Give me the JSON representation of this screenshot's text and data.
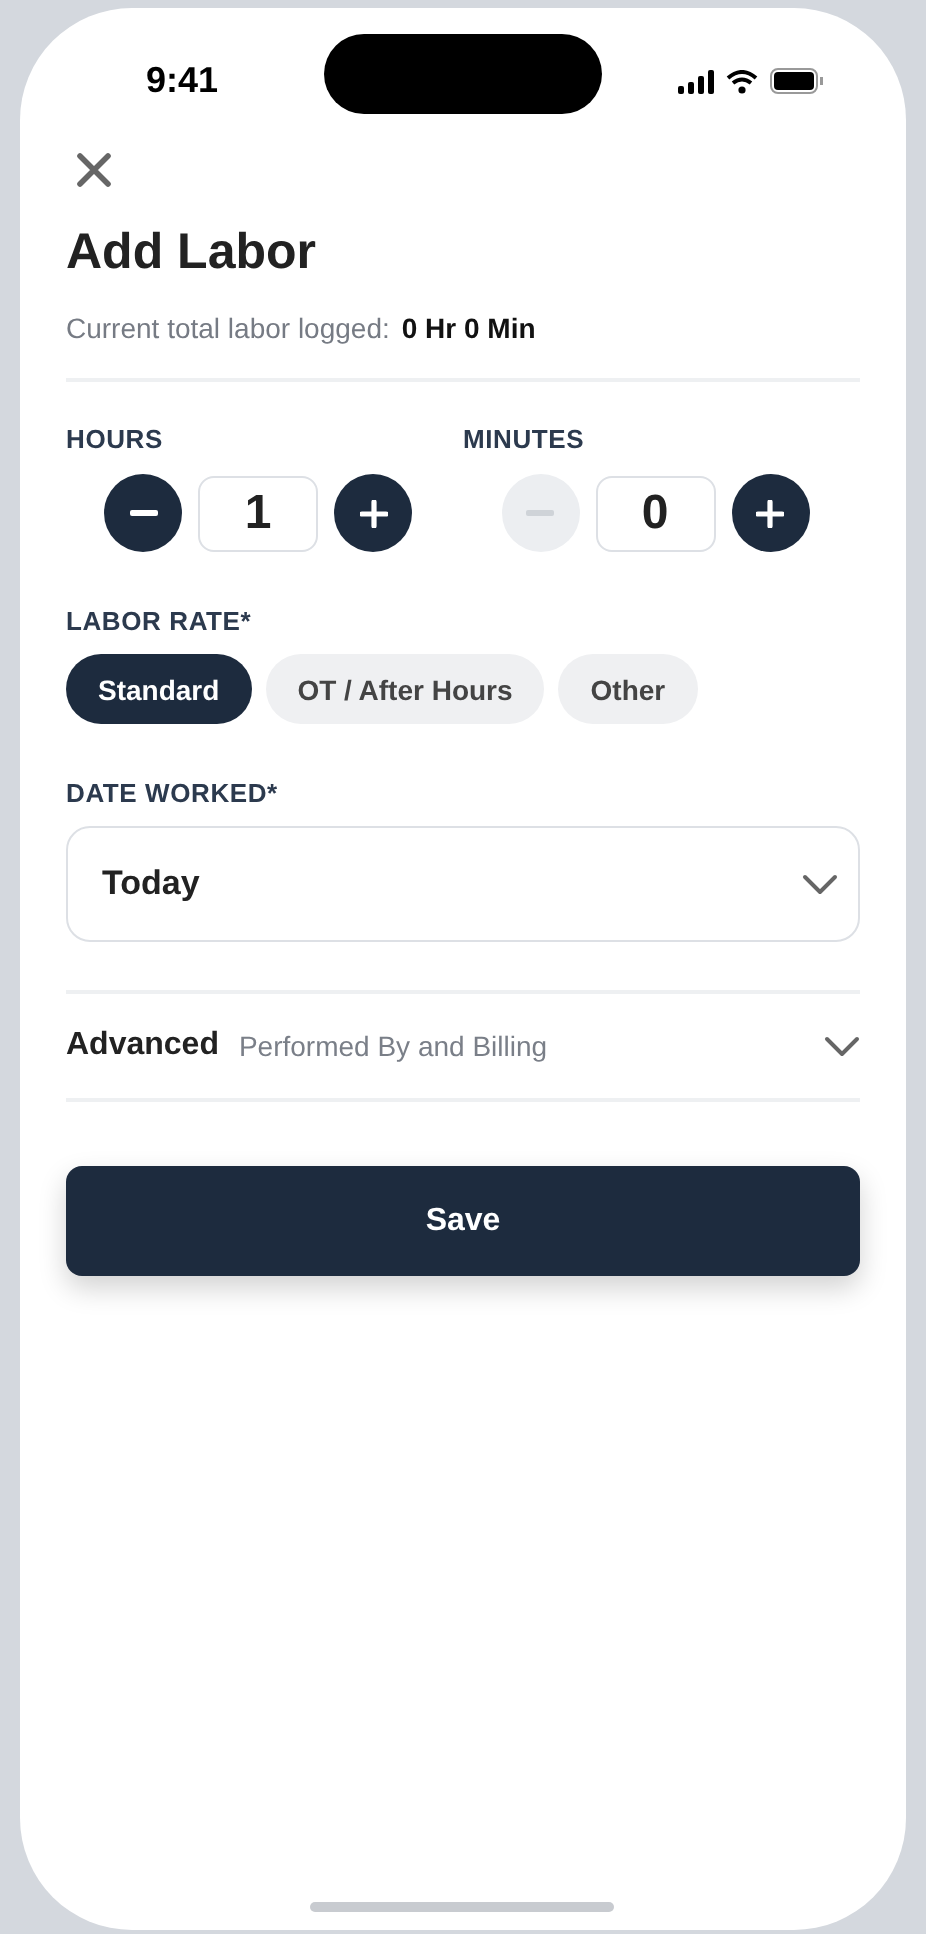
{
  "status_bar": {
    "time": "9:41"
  },
  "title": "Add Labor",
  "summary": {
    "label": "Current total labor logged:",
    "value": "0 Hr 0 Min"
  },
  "steppers": [
    {
      "label": "HOURS",
      "value": "1",
      "decrement_disabled": false
    },
    {
      "label": "MINUTES",
      "value": "0",
      "decrement_disabled": true
    }
  ],
  "labor_rate": {
    "label": "LABOR RATE*",
    "options": [
      {
        "label": "Standard",
        "selected": true
      },
      {
        "label": "OT / After Hours",
        "selected": false
      },
      {
        "label": "Other",
        "selected": false
      }
    ]
  },
  "date_worked": {
    "label": "DATE WORKED*",
    "value": "Today"
  },
  "advanced": {
    "title": "Advanced",
    "subtitle": "Performed By and Billing",
    "expanded": false
  },
  "save_button": "Save"
}
